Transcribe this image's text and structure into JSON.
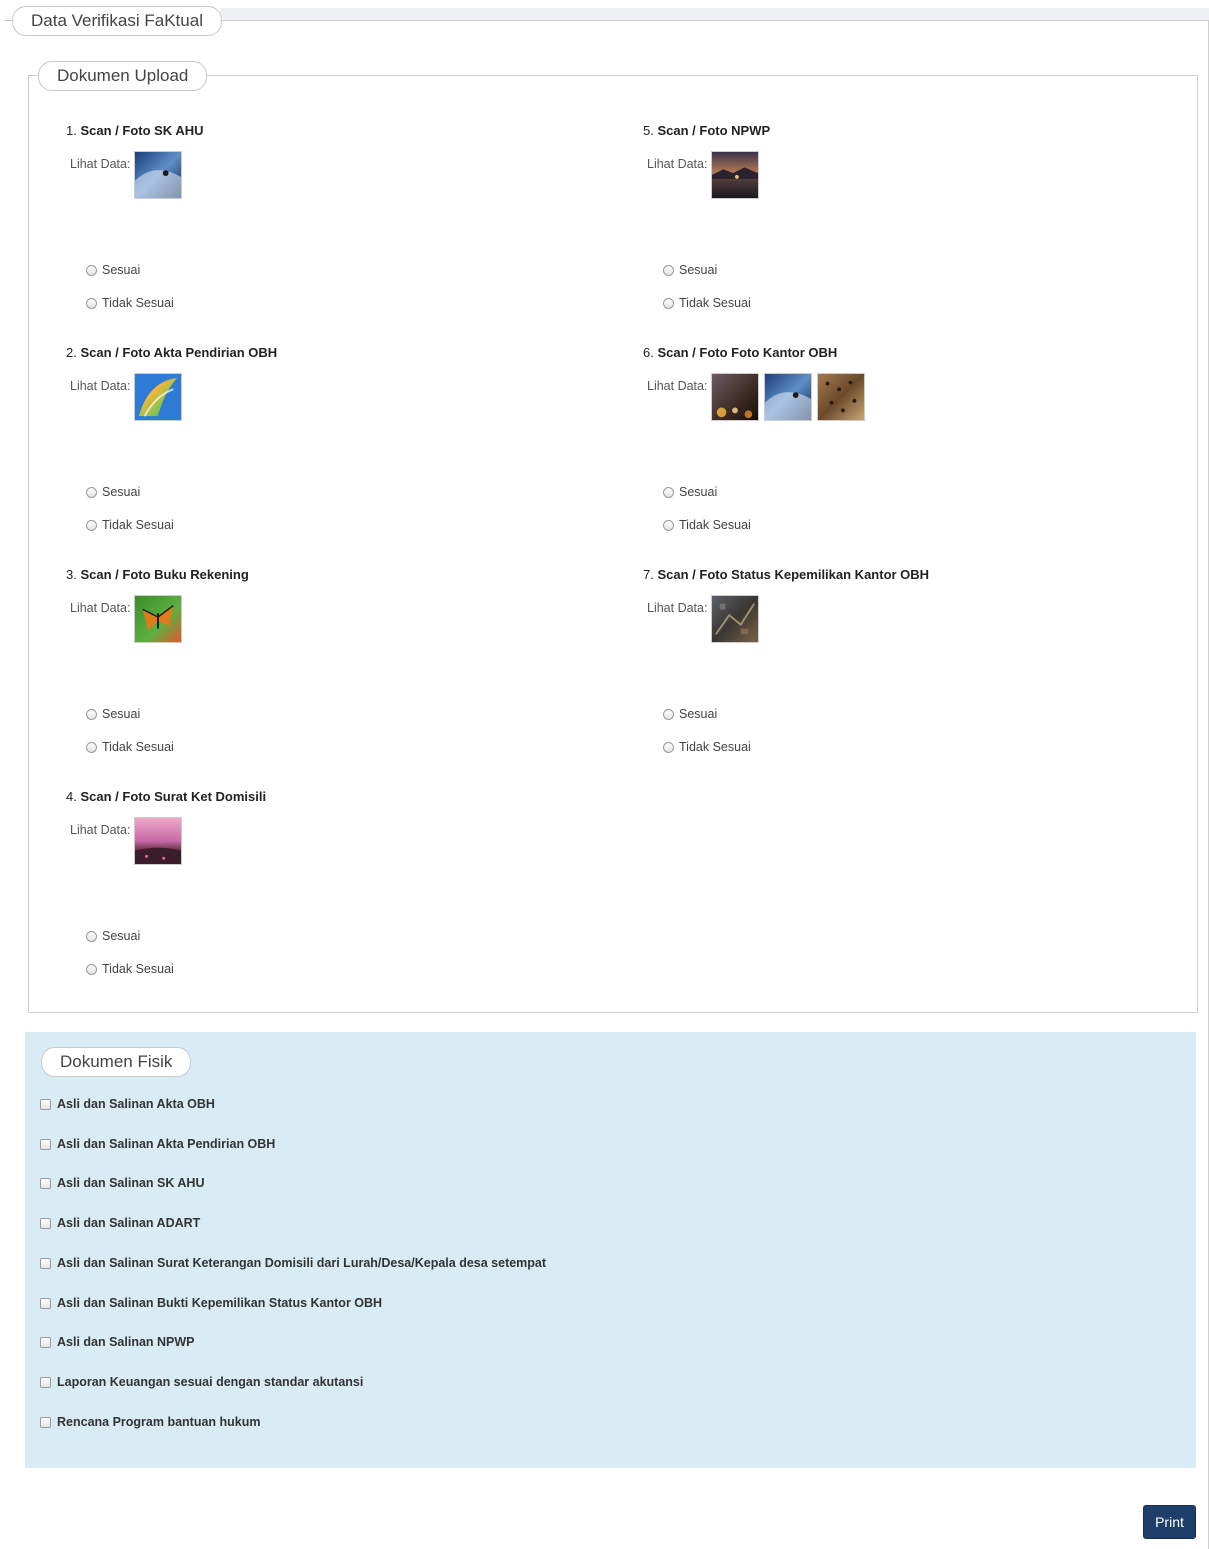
{
  "legends": {
    "main": "Data Verifikasi FaKtual",
    "upload": "Dokumen Upload",
    "fisik": "Dokumen Fisik"
  },
  "labels": {
    "lihat_data": "Lihat Data:",
    "sesuai": "Sesuai",
    "tidak_sesuai": "Tidak Sesuai"
  },
  "documents": [
    {
      "num": "1.",
      "title": "Scan / Foto SK AHU",
      "thumbs": [
        "wave-surfer-image"
      ]
    },
    {
      "num": "2.",
      "title": "Scan / Foto Akta Pendirian OBH",
      "thumbs": [
        "windows7-logo-image"
      ]
    },
    {
      "num": "3.",
      "title": "Scan / Foto Buku Rekening",
      "thumbs": [
        "butterfly-image"
      ]
    },
    {
      "num": "4.",
      "title": "Scan / Foto Surat Ket Domisili",
      "thumbs": [
        "sunset-field-image"
      ]
    },
    {
      "num": "5.",
      "title": "Scan / Foto NPWP",
      "thumbs": [
        "night-lake-image"
      ]
    },
    {
      "num": "6.",
      "title": "Scan / Foto Foto Kantor OBH",
      "thumbs": [
        "bokeh-lights-image",
        "wave-surfer-image",
        "cheetah-image"
      ]
    },
    {
      "num": "7.",
      "title": "Scan / Foto Status Kepemilikan Kantor OBH",
      "thumbs": [
        "aerial-city-image"
      ]
    }
  ],
  "fisik_items": [
    "Asli dan Salinan Akta OBH",
    "Asli dan Salinan Akta Pendirian OBH",
    "Asli dan Salinan SK AHU",
    "Asli dan Salinan ADART",
    "Asli dan Salinan Surat Keterangan Domisili dari Lurah/Desa/Kepala desa setempat",
    "Asli dan Salinan Bukti Kepemilikan Status Kantor OBH",
    "Asli dan Salinan NPWP",
    "Laporan Keuangan sesuai dengan standar akutansi",
    "Rencana Program bantuan hukum"
  ],
  "print_label": "Print"
}
